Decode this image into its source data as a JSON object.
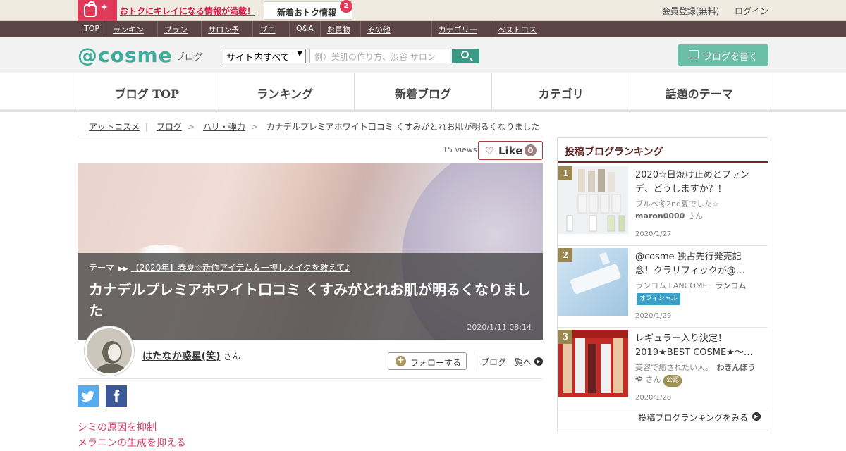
{
  "promo": {
    "text": "おトクにキレイになる情報が満載！",
    "new_info_label": "新着おトク情報",
    "new_info_count": "2",
    "register": "会員登録(無料)",
    "login": "ログイン"
  },
  "darknav": {
    "items": [
      "TOP",
      "ランキング",
      "ブランド",
      "サロン予約",
      "ブログ",
      "Q&A",
      "お買物▾",
      "その他▾"
    ],
    "right": [
      "カテゴリ一覧",
      "ベストコスメ"
    ]
  },
  "header": {
    "logo": "@cosme",
    "logo_sub": "ブログ",
    "select_value": "サイト内すべて",
    "search_placeholder": "例）美肌の作り方、渋谷 サロン",
    "write_button": "ブログを書く"
  },
  "mainnav": [
    "ブログ TOP",
    "ランキング",
    "新着ブログ",
    "カテゴリ",
    "話題のテーマ"
  ],
  "breadcrumb": {
    "items": [
      "アットコスメ",
      "ブログ",
      "ハリ・弾力"
    ],
    "current": "カナデルプレミアホワイト口コミ くすみがとれお肌が明るくなりました"
  },
  "article": {
    "views": "15 views",
    "like_label": "Like",
    "like_count": "0",
    "theme_label": "テーマ",
    "theme_link": "【2020年】春夏☆新作アイテム＆一押しメイクを教えて♪",
    "title": "カナデルプレミアホワイト口コミ くすみがとれお肌が明るくなりました",
    "date": "2020/1/11 08:14",
    "author": "はたなか惑星(笑)",
    "author_suffix": "さん",
    "follow_button": "フォローする",
    "blog_list": "ブログ一覧へ",
    "body_lines": [
      "シミの原因を抑制",
      "メラニンの生成を抑える"
    ]
  },
  "sidebar": {
    "title": "投稿ブログランキング",
    "items": [
      {
        "rank": "1",
        "title": "2020☆日焼け止めとファンデ、どうしますか？！",
        "author_prefix": "ブルベ冬2nd夏でした☆",
        "author": "maron0000",
        "suffix": "さん",
        "date": "2020/1/27"
      },
      {
        "rank": "2",
        "title": "@cosme 独占先行発売記念！クラリフィックが@…",
        "author_prefix": "ランコム LANCOME",
        "author": "ランコム",
        "badge": "オフィシャル",
        "date": "2020/1/29"
      },
      {
        "rank": "3",
        "title": "レギュラー入り決定！2019★BEST COSME★～…",
        "author_prefix": "美容で癒されたい人。",
        "author": "わきんぼうや",
        "suffix": "さん",
        "badge": "公認",
        "date": "2020/1/28"
      }
    ],
    "more": "投稿ブログランキングをみる"
  },
  "colors": {
    "accent": "#3dae9b",
    "brand_dark": "#5e4545",
    "rank_gold": "#9b8850",
    "pink": "#d0416a"
  }
}
